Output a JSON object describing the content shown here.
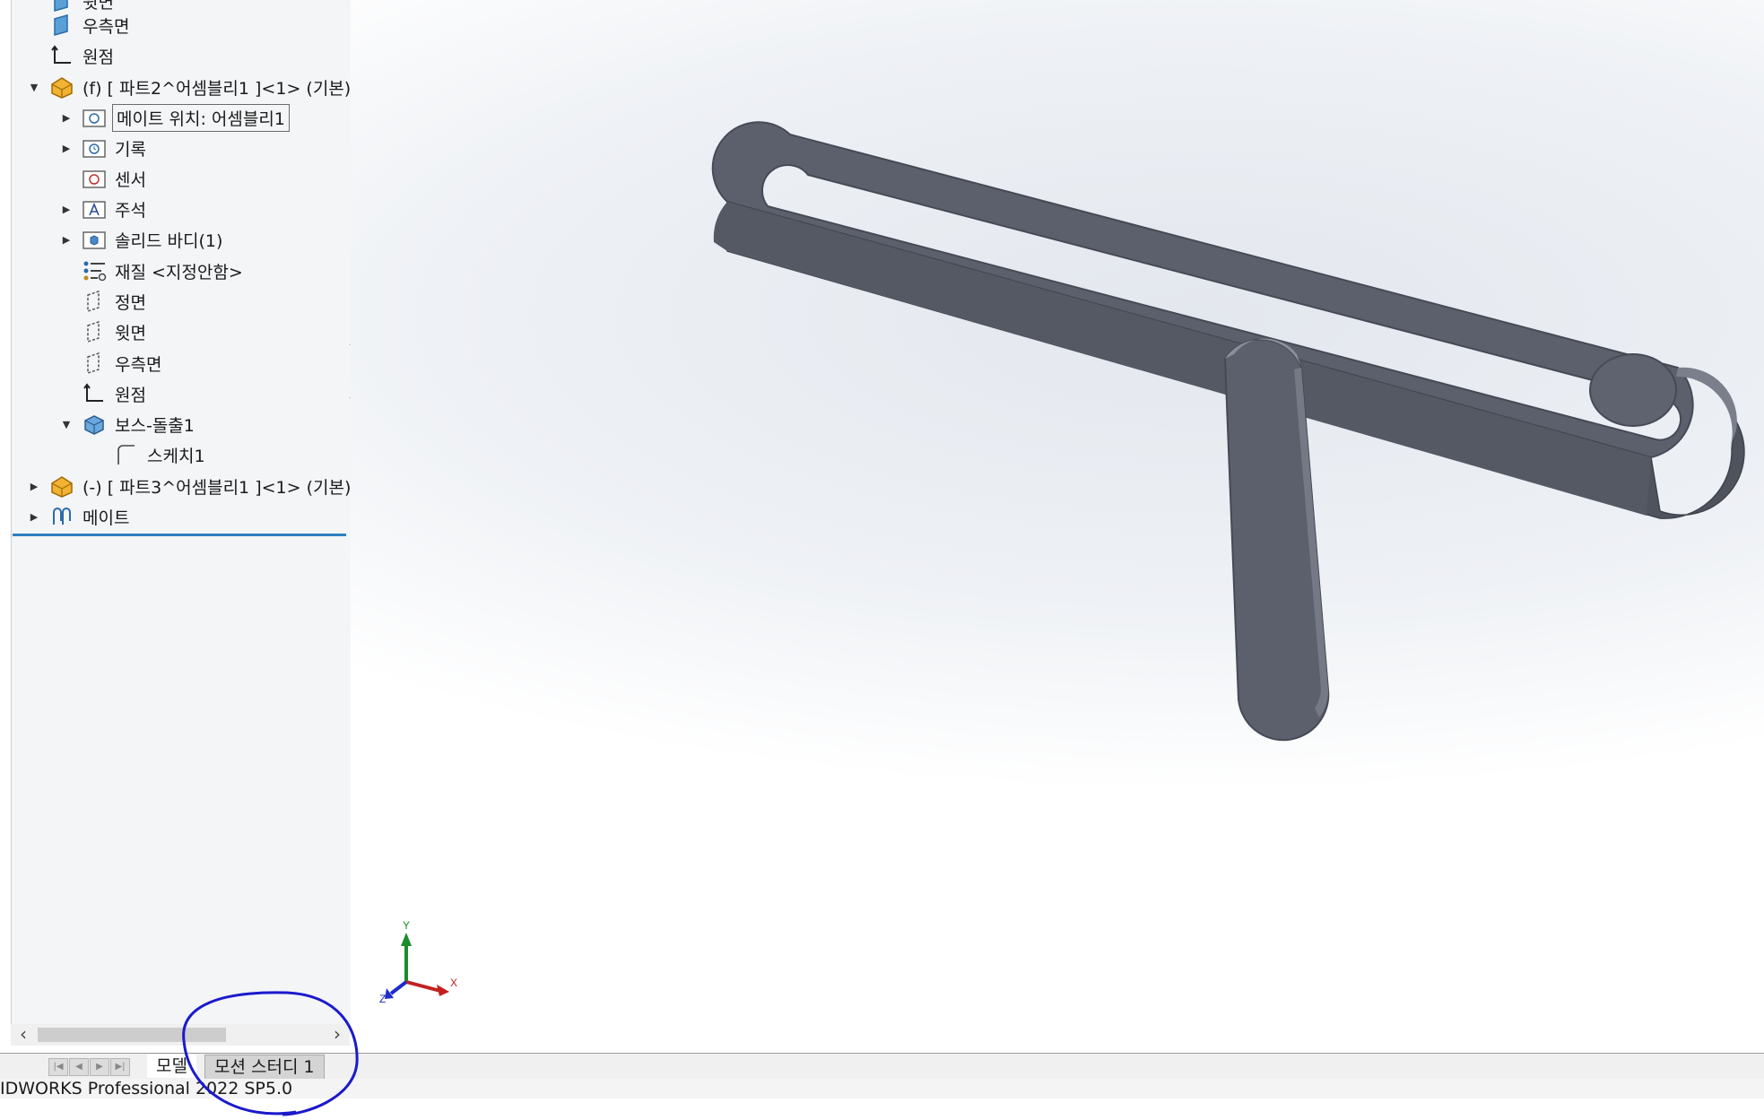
{
  "feature_tree": {
    "items": [
      {
        "label": "윗면",
        "icon": "plane-icon",
        "arrow": "none"
      },
      {
        "label": "우측면",
        "icon": "plane-icon",
        "arrow": "none"
      },
      {
        "label": "원점",
        "icon": "origin-icon",
        "arrow": "none"
      },
      {
        "label": "(f) [ 파트2^어셈블리1 ]<1> (기본)",
        "icon": "part-icon",
        "arrow": "expanded"
      },
      {
        "label": "메이트 위치: 어셈블리1",
        "icon": "mate-folder-icon",
        "arrow": "collapsed"
      },
      {
        "label": "기록",
        "icon": "history-folder-icon",
        "arrow": "collapsed"
      },
      {
        "label": "센서",
        "icon": "sensor-folder-icon",
        "arrow": "none"
      },
      {
        "label": "주석",
        "icon": "annotation-folder-icon",
        "arrow": "collapsed"
      },
      {
        "label": "솔리드 바디(1)",
        "icon": "solid-body-folder-icon",
        "arrow": "collapsed"
      },
      {
        "label": "재질 <지정안함>",
        "icon": "material-icon",
        "arrow": "none"
      },
      {
        "label": "정면",
        "icon": "plane-outline-icon",
        "arrow": "none"
      },
      {
        "label": "윗면",
        "icon": "plane-outline-icon",
        "arrow": "none"
      },
      {
        "label": "우측면",
        "icon": "plane-outline-icon",
        "arrow": "none"
      },
      {
        "label": "원점",
        "icon": "origin-icon",
        "arrow": "none"
      },
      {
        "label": "보스-돌출1",
        "icon": "extrude-icon",
        "arrow": "expanded"
      },
      {
        "label": "스케치1",
        "icon": "sketch-icon",
        "arrow": "none"
      },
      {
        "label": "(-) [ 파트3^어셈블리1 ]<1> (기본)",
        "icon": "part-icon",
        "arrow": "collapsed"
      },
      {
        "label": "메이트",
        "icon": "mates-icon",
        "arrow": "collapsed"
      }
    ]
  },
  "triad": {
    "x": "X",
    "y": "Y",
    "z": "Z"
  },
  "tabs": [
    {
      "label": "모델",
      "active": true
    },
    {
      "label": "모션 스터디 1",
      "active": false
    }
  ],
  "status": {
    "text": "IDWORKS Professional 2022 SP5.0"
  },
  "colors": {
    "accent": "#2d7fc1",
    "annotation": "#1a1acc",
    "model": "#5b606c"
  }
}
